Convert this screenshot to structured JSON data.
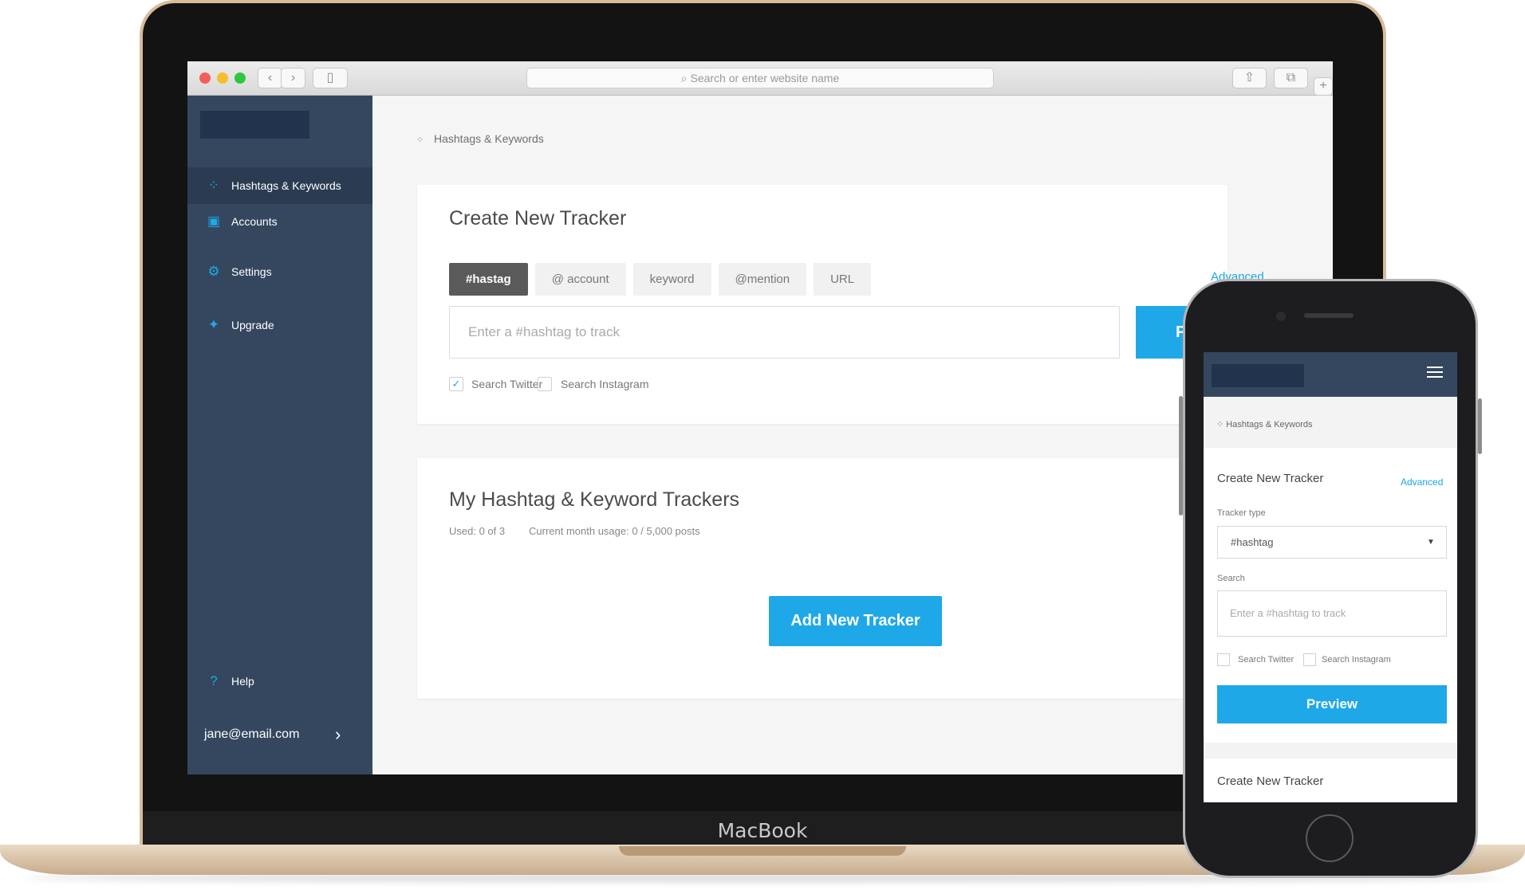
{
  "device": {
    "laptop_label": "MacBook"
  },
  "browser": {
    "address_placeholder": "Search or enter website name",
    "icons": [
      "back-icon",
      "forward-icon",
      "sidebar-icon",
      "share-icon",
      "tabs-icon",
      "plus-icon"
    ]
  },
  "sidebar": {
    "items": [
      {
        "label": "Hashtags & Keywords",
        "icon": "hashtag-grid-icon"
      },
      {
        "label": "Accounts",
        "icon": "account-icon"
      },
      {
        "label": "Settings",
        "icon": "gear-icon"
      },
      {
        "label": "Upgrade",
        "icon": "sparkle-icon"
      },
      {
        "label": "Help",
        "icon": "help-icon"
      }
    ],
    "user_email": "jane@email.com"
  },
  "main": {
    "breadcrumb": "Hashtags & Keywords",
    "create": {
      "title": "Create New Tracker",
      "tabs": [
        "#hastag",
        "@ account",
        "keyword",
        "@mention",
        "URL"
      ],
      "advanced": "Advanced",
      "placeholder": "Enter a #hashtag to track",
      "preview_visible": "P",
      "checks": [
        {
          "label": "Search Twitter",
          "checked": true
        },
        {
          "label": "Search Instagram",
          "checked": false
        }
      ]
    },
    "trackers": {
      "title": "My Hashtag & Keyword Trackers",
      "used": "Used: 0 of 3",
      "usage": "Current month usage: 0 / 5,000 posts",
      "button": "Add New Tracker"
    }
  },
  "phone": {
    "breadcrumb": "Hashtags & Keywords",
    "title": "Create New Tracker",
    "advanced": "Advanced",
    "tracker_type_label": "Tracker type",
    "tracker_type_value": "#hashtag",
    "search_label": "Search",
    "placeholder": "Enter a #hashtag to track",
    "checks": [
      "Search Twitter",
      "Search Instagram"
    ],
    "preview": "Preview",
    "second_title": "Create New Tracker"
  },
  "colors": {
    "accent": "#1fa8e8",
    "sidebar": "#34475e",
    "active": "#5a5a5a"
  }
}
